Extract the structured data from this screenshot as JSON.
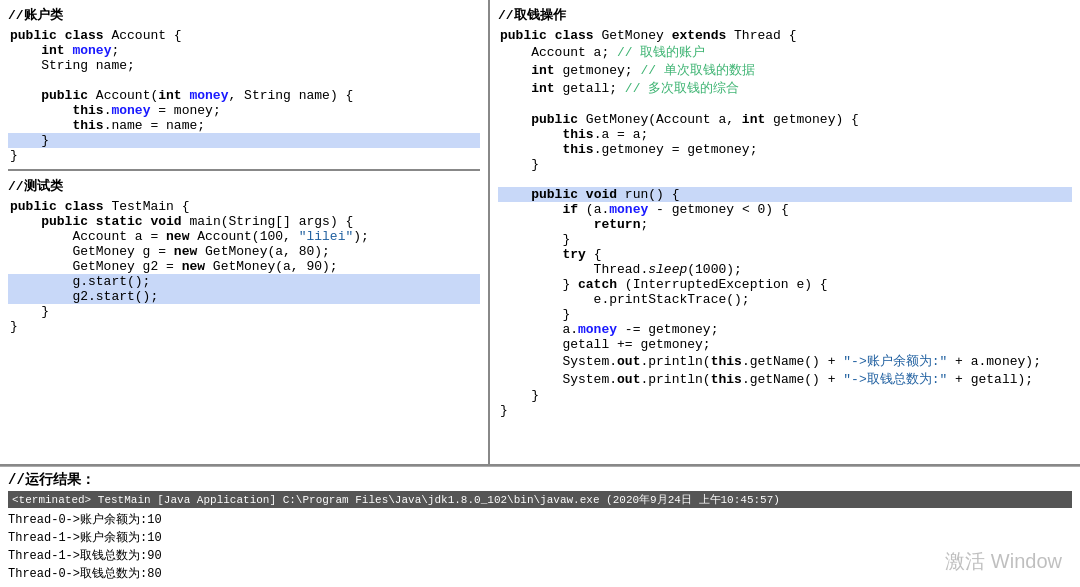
{
  "left_panel": {
    "section1_title": "//账户类",
    "section1_code": [
      {
        "text": "public class Account {",
        "bold_parts": [
          "public",
          "class"
        ],
        "selected": false,
        "indent": 0
      },
      {
        "text": "    int money;",
        "bold_parts": [
          "int"
        ],
        "selected": false,
        "indent": 1
      },
      {
        "text": "    String name;",
        "bold_parts": [
          "String"
        ],
        "selected": false,
        "indent": 1
      },
      {
        "text": "",
        "selected": false
      },
      {
        "text": "    public Account(int money, String name) {",
        "bold_parts": [
          "public",
          "int",
          "String"
        ],
        "selected": false,
        "indent": 1
      },
      {
        "text": "        this.money = money;",
        "bold_parts": [
          "this"
        ],
        "selected": false,
        "indent": 2
      },
      {
        "text": "        this.name = name;",
        "bold_parts": [
          "this"
        ],
        "selected": false,
        "indent": 2
      },
      {
        "text": "    }",
        "selected": true,
        "indent": 1
      },
      {
        "text": "}",
        "selected": false,
        "indent": 0
      }
    ],
    "section2_title": "//测试类",
    "section2_code": [
      {
        "text": "public class TestMain {",
        "selected": false
      },
      {
        "text": "    public static void main(String[] args) {",
        "selected": false
      },
      {
        "text": "        Account a = new Account(100, \"lilei\");",
        "selected": false
      },
      {
        "text": "        GetMoney g = new GetMoney(a, 80);",
        "selected": false
      },
      {
        "text": "        GetMoney g2 = new GetMoney(a, 90);",
        "selected": false
      },
      {
        "text": "        g.start();",
        "selected": true
      },
      {
        "text": "        g2.start();",
        "selected": true
      },
      {
        "text": "    }",
        "selected": false
      },
      {
        "text": "}",
        "selected": false
      }
    ]
  },
  "right_panel": {
    "section_title": "//取钱操作",
    "code": [
      {
        "text": "public class GetMoney extends Thread {"
      },
      {
        "text": "    Account a; // 取钱的账户",
        "comment": true,
        "comment_part": " // 取钱的账户"
      },
      {
        "text": "    int getmoney; // 单次取钱的数据",
        "comment": true,
        "comment_part": " // 单次取钱的数据"
      },
      {
        "text": "    int getall; // 多次取钱的综合",
        "comment": true,
        "comment_part": " // 多次取钱的综合"
      },
      {
        "text": ""
      },
      {
        "text": "    public GetMoney(Account a, int getmoney) {"
      },
      {
        "text": "        this.a = a;"
      },
      {
        "text": "        this.getmoney = getmoney;"
      },
      {
        "text": "    }"
      },
      {
        "text": ""
      },
      {
        "text": "    public void run() {",
        "selected": true
      },
      {
        "text": "        if (a.money - getmoney < 0) {"
      },
      {
        "text": "            return;"
      },
      {
        "text": "        }"
      },
      {
        "text": "        try {"
      },
      {
        "text": "            Thread.sleep(1000);"
      },
      {
        "text": "        } catch (InterruptedException e) {"
      },
      {
        "text": "            e.printStackTrace();"
      },
      {
        "text": "        }"
      },
      {
        "text": "        a.money -= getmoney;"
      },
      {
        "text": "        getall += getmoney;"
      },
      {
        "text": "        System.out.println(this.getName() + \"->账户余额为:\" + a.money);"
      },
      {
        "text": "        System.out.println(this.getName() + \"->取钱总数为:\" + getall);"
      },
      {
        "text": "    }"
      },
      {
        "text": "}"
      }
    ]
  },
  "bottom": {
    "title": "//运行结果：",
    "terminated_label": "<terminated> TestMain [Java Application] C:\\Program Files\\Java\\jdk1.8.0_102\\bin\\javaw.exe (2020年9月24日 上午10:45:57)",
    "output_lines": [
      "Thread-0->账户余额为:10",
      "Thread-1->账户余额为:10",
      "Thread-1->取钱总数为:90",
      "Thread-0->取钱总数为:80"
    ]
  },
  "watermark": "激活 Window"
}
